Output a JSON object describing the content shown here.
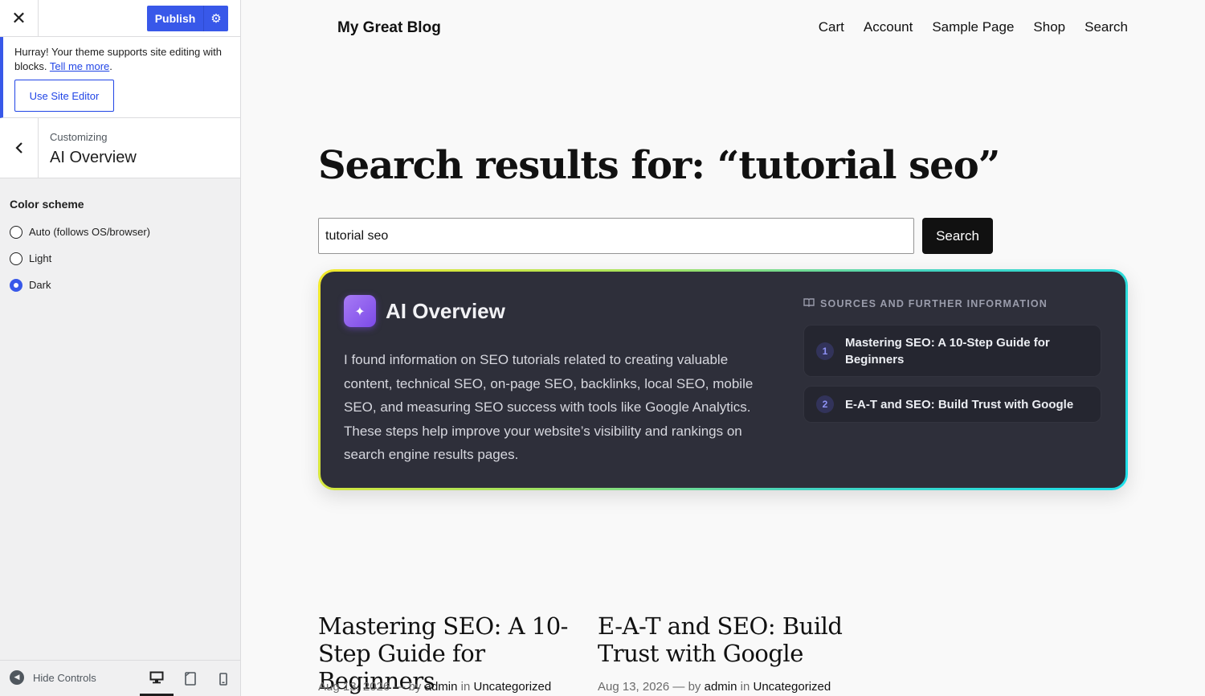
{
  "customizer": {
    "publish_label": "Publish",
    "notice": {
      "text": "Hurray! Your theme supports site editing with blocks.",
      "link_text": "Tell me more",
      "period": ".",
      "button_label": "Use Site Editor"
    },
    "section": {
      "customizing_label": "Customizing",
      "title": "AI Overview"
    },
    "color_scheme": {
      "label": "Color scheme",
      "options": [
        {
          "label": "Auto (follows OS/browser)",
          "checked": false
        },
        {
          "label": "Light",
          "checked": false
        },
        {
          "label": "Dark",
          "checked": true
        }
      ]
    },
    "footer": {
      "hide_controls_label": "Hide Controls",
      "devices": [
        "desktop-icon",
        "tablet-icon",
        "mobile-icon"
      ],
      "active_device": "desktop"
    }
  },
  "site": {
    "title": "My Great Blog",
    "nav": [
      "Cart",
      "Account",
      "Sample Page",
      "Shop",
      "Search"
    ]
  },
  "search": {
    "heading": "Search results for: “tutorial seo”",
    "query": "tutorial seo",
    "button_label": "Search"
  },
  "ai_overview": {
    "title": "AI Overview",
    "body": "I found information on SEO tutorials related to creating valuable content, technical SEO, on-page SEO, backlinks, local SEO, mobile SEO, and measuring SEO success with tools like Google Analytics. These steps help improve your website’s visibility and rankings on search engine results pages.",
    "sources_heading": "SOURCES AND FURTHER INFORMATION",
    "sources": [
      {
        "num": "1",
        "title": "Mastering SEO: A 10-Step Guide for Beginners"
      },
      {
        "num": "2",
        "title": "E-A-T and SEO: Build Trust with Google"
      }
    ]
  },
  "posts": [
    {
      "title": "Mastering SEO: A 10-Step Guide for Beginners",
      "date": "Aug 13, 2026",
      "by": "— by",
      "author": "admin",
      "in": "in",
      "category": "Uncategorized"
    },
    {
      "title": "E-A-T and SEO: Build Trust with Google",
      "date": "Aug 13, 2026",
      "by": "— by",
      "author": "admin",
      "in": "in",
      "category": "Uncategorized"
    }
  ],
  "colors": {
    "accent": "#3858e9",
    "card_bg": "#2e2f3a",
    "gradient_start": "#f3e92b",
    "gradient_end": "#1ddfe9"
  }
}
